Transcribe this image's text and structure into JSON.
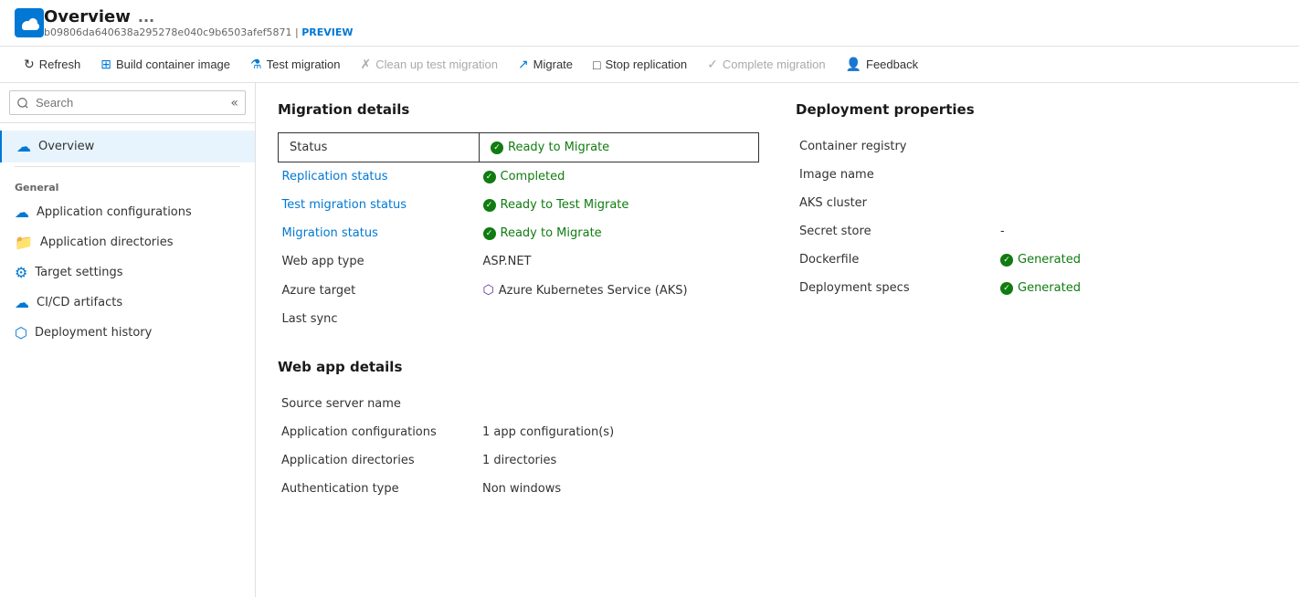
{
  "header": {
    "title": "Overview",
    "dots": "...",
    "subtitle": "b09806da640638a295278e040c9b6503afef5871",
    "separator": "|",
    "preview_label": "PREVIEW"
  },
  "toolbar": {
    "refresh_label": "Refresh",
    "build_container_label": "Build container image",
    "test_migration_label": "Test migration",
    "clean_up_label": "Clean up test migration",
    "migrate_label": "Migrate",
    "stop_replication_label": "Stop replication",
    "complete_migration_label": "Complete migration",
    "feedback_label": "Feedback"
  },
  "sidebar": {
    "search_placeholder": "Search",
    "overview_label": "Overview",
    "general_label": "General",
    "items": [
      {
        "label": "Application configurations",
        "icon": "cloud"
      },
      {
        "label": "Application directories",
        "icon": "folder"
      },
      {
        "label": "Target settings",
        "icon": "gear"
      },
      {
        "label": "CI/CD artifacts",
        "icon": "cloud"
      },
      {
        "label": "Deployment history",
        "icon": "cube"
      }
    ]
  },
  "migration_details": {
    "section_title": "Migration details",
    "rows": [
      {
        "label": "Status",
        "value": "Ready to Migrate",
        "type": "status_highlight",
        "badge": "green"
      },
      {
        "label": "Replication status",
        "value": "Completed",
        "type": "badge",
        "badge": "green",
        "link": true
      },
      {
        "label": "Test migration status",
        "value": "Ready to Test Migrate",
        "type": "badge",
        "badge": "green",
        "link": true
      },
      {
        "label": "Migration status",
        "value": "Ready to Migrate",
        "type": "badge",
        "badge": "green",
        "link": true
      },
      {
        "label": "Web app type",
        "value": "ASP.NET",
        "type": "plain"
      },
      {
        "label": "Azure target",
        "value": "Azure Kubernetes Service (AKS)",
        "type": "aks",
        "badge": "purple"
      },
      {
        "label": "Last sync",
        "value": "",
        "type": "plain"
      }
    ]
  },
  "deployment_properties": {
    "section_title": "Deployment properties",
    "rows": [
      {
        "label": "Container registry",
        "value": "",
        "type": "plain"
      },
      {
        "label": "Image name",
        "value": "",
        "type": "plain"
      },
      {
        "label": "AKS cluster",
        "value": "",
        "type": "plain"
      },
      {
        "label": "Secret store",
        "value": "-",
        "type": "plain"
      },
      {
        "label": "Dockerfile",
        "value": "Generated",
        "type": "badge",
        "badge": "green"
      },
      {
        "label": "Deployment specs",
        "value": "Generated",
        "type": "badge",
        "badge": "green"
      }
    ]
  },
  "web_app_details": {
    "section_title": "Web app details",
    "rows": [
      {
        "label": "Source server name",
        "value": "",
        "type": "plain"
      },
      {
        "label": "Application configurations",
        "value": "1 app configuration(s)",
        "type": "plain"
      },
      {
        "label": "Application directories",
        "value": "1 directories",
        "type": "plain"
      },
      {
        "label": "Authentication type",
        "value": "Non windows",
        "type": "plain"
      }
    ]
  }
}
